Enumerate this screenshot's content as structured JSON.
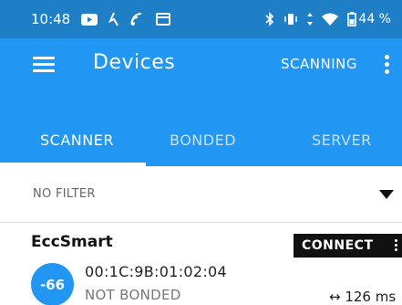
{
  "status_bar": {
    "time": "10:48",
    "battery": "44 %",
    "icons_left": [
      "youtube-icon",
      "direction-icon",
      "screen-share-icon",
      "cast-icon"
    ],
    "icons_right": [
      "bluetooth-icon",
      "vibrate-icon",
      "signal-icon",
      "wifi-icon",
      "battery-icon"
    ]
  },
  "app_bar": {
    "title": "Devices",
    "scanning_label": "SCANNING"
  },
  "tabs": [
    {
      "label": "SCANNER",
      "active": true
    },
    {
      "label": "BONDED",
      "active": false
    },
    {
      "label": "SERVER",
      "active": false
    }
  ],
  "filter": {
    "label": "NO FILTER"
  },
  "devices": [
    {
      "name": "EccSmart",
      "connect_label": "CONNECT",
      "rssi": "-66",
      "address": "00:1C:9B:01:02:04",
      "bond_state": "NOT BONDED",
      "interval": "↔ 126 ms"
    }
  ],
  "colors": {
    "status_bar": "#1e7fc6",
    "primary": "#2196f3",
    "connect_bg": "#111111"
  }
}
